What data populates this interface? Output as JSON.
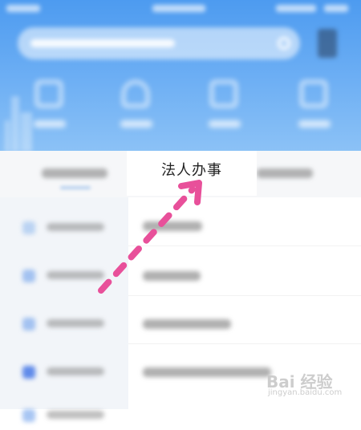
{
  "tabs": {
    "active_label": "法人办事"
  },
  "watermark": {
    "logo_text": "Bai 经验",
    "url": "jingyan.baidu.com"
  },
  "colors": {
    "header_blue": "#4d9bf0",
    "accent_pink": "#e8509a"
  }
}
